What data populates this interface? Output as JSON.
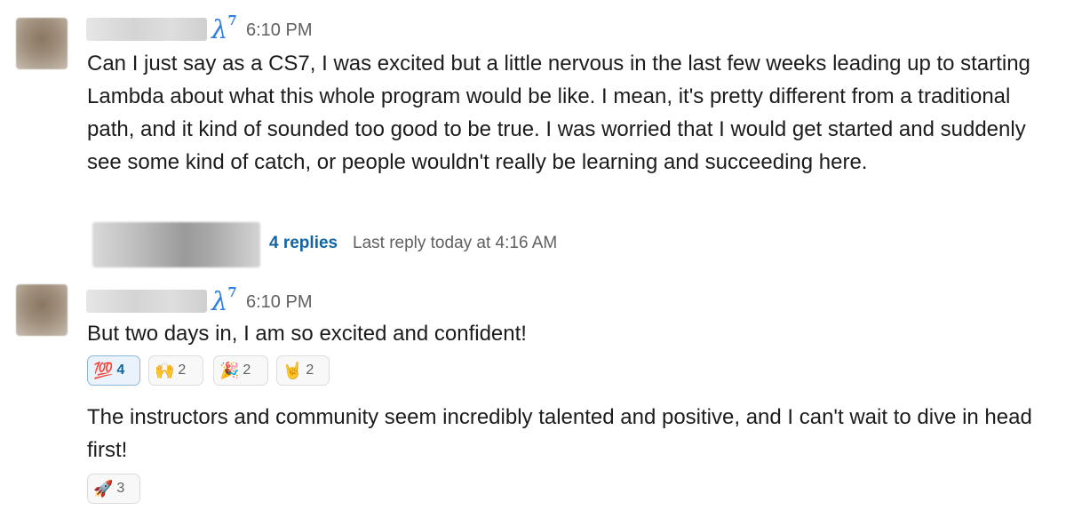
{
  "messages": [
    {
      "badge": "λ",
      "badge_sup": "7",
      "time": "6:10 PM",
      "text": "Can I just say as a CS7, I was excited but a little nervous in the last few weeks leading up to starting Lambda about what this whole program would be like. I mean, it's pretty different from a traditional path, and it kind of sounded too good to be true.  I was worried that I would get started and suddenly see some kind of catch, or people wouldn't really be learning and succeeding here.",
      "thread": {
        "replies": "4 replies",
        "last_reply": "Last reply today at 4:16 AM"
      }
    },
    {
      "badge": "λ",
      "badge_sup": "7",
      "time": "6:10 PM",
      "text": "But two days in, I am so excited and confident!",
      "reactions": [
        {
          "emoji": "💯",
          "count": "4",
          "active": true
        },
        {
          "emoji": "🙌",
          "count": "2"
        },
        {
          "emoji": "🎉",
          "count": "2"
        },
        {
          "emoji": "🤘",
          "count": "2"
        }
      ],
      "followup_text": "The instructors and community seem incredibly talented and positive, and I can't wait to dive in head first!",
      "followup_reactions": [
        {
          "emoji": "🚀",
          "count": "3"
        }
      ]
    }
  ]
}
